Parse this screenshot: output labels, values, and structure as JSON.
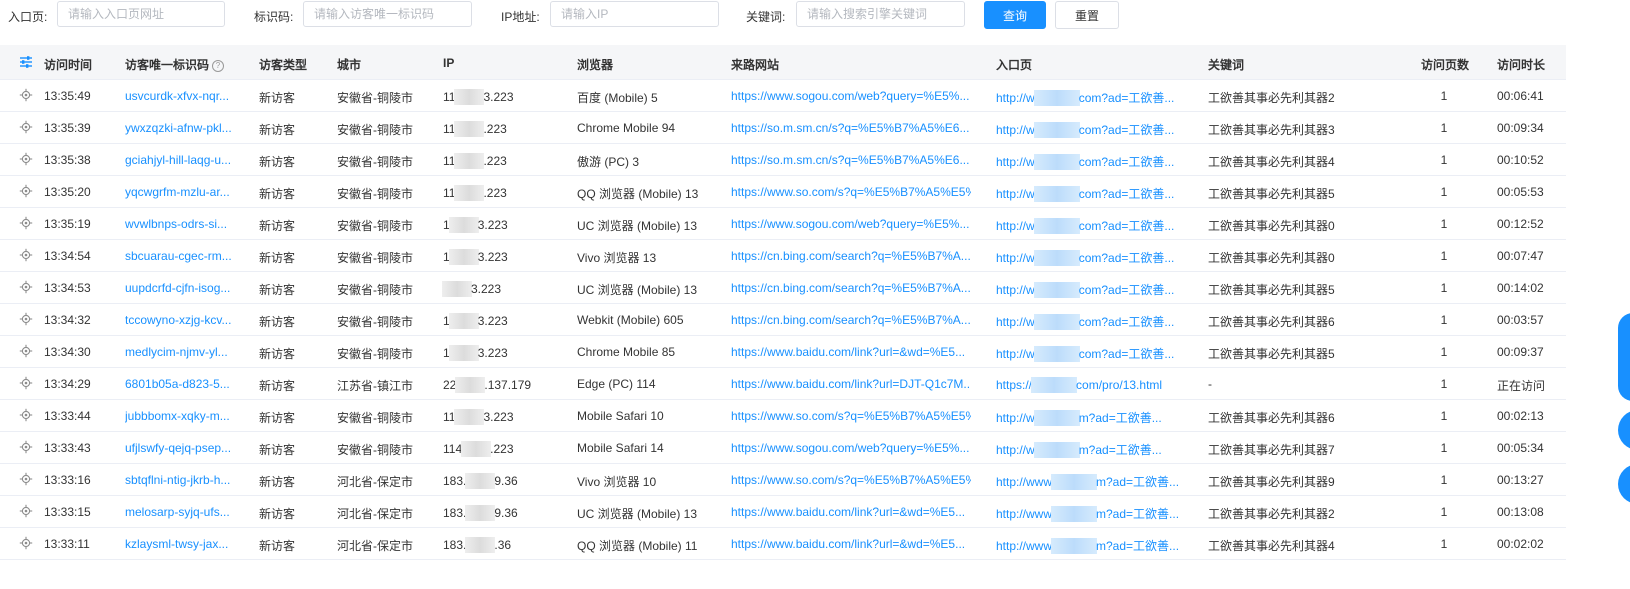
{
  "filters": {
    "entry_label": "入口页:",
    "entry_placeholder": "请输入入口页网址",
    "visitor_label": "标识码:",
    "visitor_placeholder": "请输入访客唯一标识码",
    "ip_label": "IP地址:",
    "ip_placeholder": "请输入IP",
    "keyword_label": "关键词:",
    "keyword_placeholder": "请输入搜索引擎关键词",
    "query_button": "查询",
    "reset_button": "重置"
  },
  "columns": {
    "time": "访问时间",
    "visitor_id": "访客唯一标识码",
    "visitor_type": "访客类型",
    "city": "城市",
    "ip": "IP",
    "browser": "浏览器",
    "referrer": "来路网站",
    "entry_page": "入口页",
    "keyword": "关键词",
    "pages": "访问页数",
    "duration": "访问时长"
  },
  "icons": {
    "settings": "settings-sliders-icon",
    "help": "help-circle-icon",
    "row": "target-crosshair-icon"
  },
  "colors": {
    "accent": "#1890ff",
    "header_bg": "#f5f6f8",
    "border": "#ebeef5",
    "text": "#333333"
  },
  "rows": [
    {
      "time": "13:35:49",
      "visitor_id": "usvcurdk-xfvx-nqr...",
      "visitor_type": "新访客",
      "city": "安徽省-铜陵市",
      "ip_pre": "11",
      "ip_post": "3.223",
      "browser": "百度 (Mobile) 5",
      "referrer": "https://www.sogou.com/web?query=%E5%...",
      "entry_pre": "http://w",
      "entry_post": "com?ad=工欲善...",
      "keyword": "工欲善其事必先利其器2",
      "pages": "1",
      "duration": "00:06:41"
    },
    {
      "time": "13:35:39",
      "visitor_id": "ywxzqzki-afnw-pkl...",
      "visitor_type": "新访客",
      "city": "安徽省-铜陵市",
      "ip_pre": "11",
      "ip_post": ".223",
      "browser": "Chrome Mobile 94",
      "referrer": "https://so.m.sm.cn/s?q=%E5%B7%A5%E6...",
      "entry_pre": "http://w",
      "entry_post": "com?ad=工欲善...",
      "keyword": "工欲善其事必先利其器3",
      "pages": "1",
      "duration": "00:09:34"
    },
    {
      "time": "13:35:38",
      "visitor_id": "gciahjyl-hill-laqg-u...",
      "visitor_type": "新访客",
      "city": "安徽省-铜陵市",
      "ip_pre": "11",
      "ip_post": ".223",
      "browser": "傲游 (PC) 3",
      "referrer": "https://so.m.sm.cn/s?q=%E5%B7%A5%E6...",
      "entry_pre": "http://w",
      "entry_post": "com?ad=工欲善...",
      "keyword": "工欲善其事必先利其器4",
      "pages": "1",
      "duration": "00:10:52"
    },
    {
      "time": "13:35:20",
      "visitor_id": "yqcwgrfm-mzlu-ar...",
      "visitor_type": "新访客",
      "city": "安徽省-铜陵市",
      "ip_pre": "11",
      "ip_post": ".223",
      "browser": "QQ 浏览器 (Mobile) 13",
      "referrer": "https://www.so.com/s?q=%E5%B7%A5%E5%...",
      "entry_pre": "http://w",
      "entry_post": "com?ad=工欲善...",
      "keyword": "工欲善其事必先利其器5",
      "pages": "1",
      "duration": "00:05:53"
    },
    {
      "time": "13:35:19",
      "visitor_id": "wvwlbnps-odrs-si...",
      "visitor_type": "新访客",
      "city": "安徽省-铜陵市",
      "ip_pre": "1",
      "ip_post": "3.223",
      "browser": "UC 浏览器 (Mobile) 13",
      "referrer": "https://www.sogou.com/web?query=%E5%...",
      "entry_pre": "http://w",
      "entry_post": "com?ad=工欲善...",
      "keyword": "工欲善其事必先利其器0",
      "pages": "1",
      "duration": "00:12:52"
    },
    {
      "time": "13:34:54",
      "visitor_id": "sbcuarau-cgec-rm...",
      "visitor_type": "新访客",
      "city": "安徽省-铜陵市",
      "ip_pre": "1",
      "ip_post": "3.223",
      "browser": "Vivo 浏览器 13",
      "referrer": "https://cn.bing.com/search?q=%E5%B7%A...",
      "entry_pre": "http://w",
      "entry_post": "com?ad=工欲善...",
      "keyword": "工欲善其事必先利其器0",
      "pages": "1",
      "duration": "00:07:47"
    },
    {
      "time": "13:34:53",
      "visitor_id": "uupdcrfd-cjfn-isog...",
      "visitor_type": "新访客",
      "city": "安徽省-铜陵市",
      "ip_pre": "",
      "ip_post": "3.223",
      "browser": "UC 浏览器 (Mobile) 13",
      "referrer": "https://cn.bing.com/search?q=%E5%B7%A...",
      "entry_pre": "http://w",
      "entry_post": "com?ad=工欲善...",
      "keyword": "工欲善其事必先利其器5",
      "pages": "1",
      "duration": "00:14:02"
    },
    {
      "time": "13:34:32",
      "visitor_id": "tccowyno-xzjg-kcv...",
      "visitor_type": "新访客",
      "city": "安徽省-铜陵市",
      "ip_pre": "1",
      "ip_post": "3.223",
      "browser": "Webkit (Mobile) 605",
      "referrer": "https://cn.bing.com/search?q=%E5%B7%A...",
      "entry_pre": "http://w",
      "entry_post": "com?ad=工欲善...",
      "keyword": "工欲善其事必先利其器6",
      "pages": "1",
      "duration": "00:03:57"
    },
    {
      "time": "13:34:30",
      "visitor_id": "medlycim-njmv-yl...",
      "visitor_type": "新访客",
      "city": "安徽省-铜陵市",
      "ip_pre": "1",
      "ip_post": "3.223",
      "browser": "Chrome Mobile 85",
      "referrer": "https://www.baidu.com/link?url=&wd=%E5...",
      "entry_pre": "http://w",
      "entry_post": "com?ad=工欲善...",
      "keyword": "工欲善其事必先利其器5",
      "pages": "1",
      "duration": "00:09:37"
    },
    {
      "time": "13:34:29",
      "visitor_id": "6801b05a-d823-5...",
      "visitor_type": "新访客",
      "city": "江苏省-镇江市",
      "ip_pre": "22",
      "ip_post": ".137.179",
      "browser": "Edge (PC) 114",
      "referrer": "https://www.baidu.com/link?url=DJT-Q1c7M...",
      "entry_pre": "https://",
      "entry_post": "com/pro/13.html",
      "keyword": "-",
      "pages": "1",
      "duration": "正在访问"
    },
    {
      "time": "13:33:44",
      "visitor_id": "jubbbomx-xqky-m...",
      "visitor_type": "新访客",
      "city": "安徽省-铜陵市",
      "ip_pre": "11",
      "ip_post": "3.223",
      "browser": "Mobile Safari 10",
      "referrer": "https://www.so.com/s?q=%E5%B7%A5%E5%...",
      "entry_pre": "http://w",
      "entry_post": "m?ad=工欲善...",
      "keyword": "工欲善其事必先利其器6",
      "pages": "1",
      "duration": "00:02:13"
    },
    {
      "time": "13:33:43",
      "visitor_id": "ufjlswfy-qejq-psep...",
      "visitor_type": "新访客",
      "city": "安徽省-铜陵市",
      "ip_pre": "114",
      "ip_post": ".223",
      "browser": "Mobile Safari 14",
      "referrer": "https://www.sogou.com/web?query=%E5%...",
      "entry_pre": "http://w",
      "entry_post": "m?ad=工欲善...",
      "keyword": "工欲善其事必先利其器7",
      "pages": "1",
      "duration": "00:05:34"
    },
    {
      "time": "13:33:16",
      "visitor_id": "sbtqflni-ntig-jkrb-h...",
      "visitor_type": "新访客",
      "city": "河北省-保定市",
      "ip_pre": "183.",
      "ip_post": "9.36",
      "browser": "Vivo 浏览器 10",
      "referrer": "https://www.so.com/s?q=%E5%B7%A5%E5%...",
      "entry_pre": "http://www",
      "entry_post": "m?ad=工欲善...",
      "keyword": "工欲善其事必先利其器9",
      "pages": "1",
      "duration": "00:13:27"
    },
    {
      "time": "13:33:15",
      "visitor_id": "melosarp-syjq-ufs...",
      "visitor_type": "新访客",
      "city": "河北省-保定市",
      "ip_pre": "183.",
      "ip_post": "9.36",
      "browser": "UC 浏览器 (Mobile) 13",
      "referrer": "https://www.baidu.com/link?url=&wd=%E5...",
      "entry_pre": "http://www",
      "entry_post": "m?ad=工欲善...",
      "keyword": "工欲善其事必先利其器2",
      "pages": "1",
      "duration": "00:13:08"
    },
    {
      "time": "13:33:11",
      "visitor_id": "kzlaysml-twsy-jax...",
      "visitor_type": "新访客",
      "city": "河北省-保定市",
      "ip_pre": "183.",
      "ip_post": ".36",
      "browser": "QQ 浏览器 (Mobile) 11",
      "referrer": "https://www.baidu.com/link?url=&wd=%E5...",
      "entry_pre": "http://www",
      "entry_post": "m?ad=工欲善...",
      "keyword": "工欲善其事必先利其器4",
      "pages": "1",
      "duration": "00:02:02"
    }
  ]
}
